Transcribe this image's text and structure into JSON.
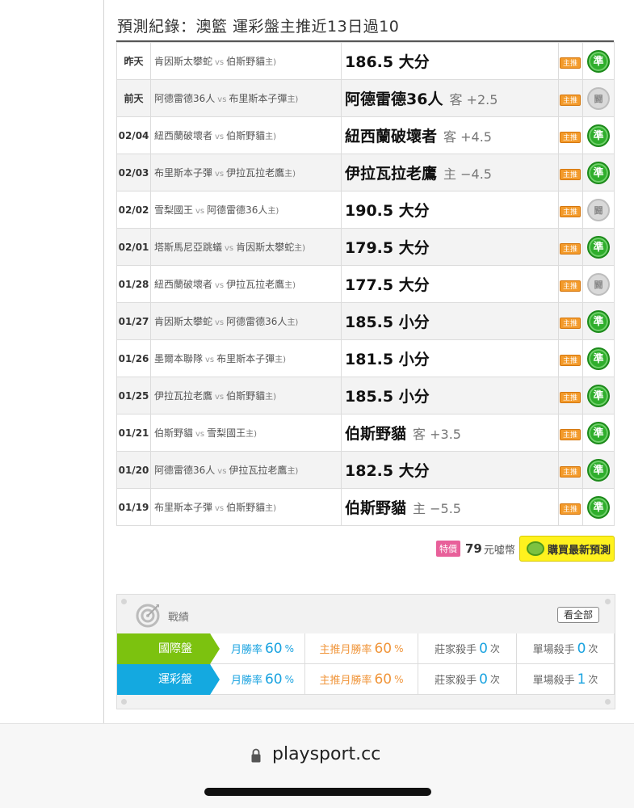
{
  "title": "預測紀錄：澳籃 運彩盤主推近13日過10",
  "tag_label": "主推",
  "vs_label": "vs",
  "records": [
    {
      "date": "昨天",
      "away": "肯因斯太攀蛇",
      "home": "伯斯野貓",
      "home_mark": "主)",
      "pick": "186.5 大分",
      "line": "",
      "result": "準"
    },
    {
      "date": "前天",
      "away": "阿德雷德36人",
      "home": "布里斯本子彈",
      "home_mark": "主)",
      "pick": "阿德雷德36人",
      "line": "客 +2.5",
      "result": "闘"
    },
    {
      "date": "02/04",
      "away": "紐西蘭破壞者",
      "home": "伯斯野貓",
      "home_mark": "主)",
      "pick": "紐西蘭破壞者",
      "line": "客 +4.5",
      "result": "準"
    },
    {
      "date": "02/03",
      "away": "布里斯本子彈",
      "home": "伊拉瓦拉老鷹",
      "home_mark": "主)",
      "pick": "伊拉瓦拉老鷹",
      "line": "主 −4.5",
      "result": "準"
    },
    {
      "date": "02/02",
      "away": "雪梨國王",
      "home": "阿德雷德36人",
      "home_mark": "主)",
      "pick": "190.5 大分",
      "line": "",
      "result": "闘"
    },
    {
      "date": "02/01",
      "away": "塔斯馬尼亞跳蟻",
      "home": "肯因斯太攀蛇",
      "home_mark": "主)",
      "pick": "179.5 大分",
      "line": "",
      "result": "準"
    },
    {
      "date": "01/28",
      "away": "紐西蘭破壞者",
      "home": "伊拉瓦拉老鷹",
      "home_mark": "主)",
      "pick": "177.5 大分",
      "line": "",
      "result": "闘"
    },
    {
      "date": "01/27",
      "away": "肯因斯太攀蛇",
      "home": "阿德雷德36人",
      "home_mark": "主)",
      "pick": "185.5 小分",
      "line": "",
      "result": "準"
    },
    {
      "date": "01/26",
      "away": "墨爾本聯隊",
      "home": "布里斯本子彈",
      "home_mark": "主)",
      "pick": "181.5 小分",
      "line": "",
      "result": "準"
    },
    {
      "date": "01/25",
      "away": "伊拉瓦拉老鷹",
      "home": "伯斯野貓",
      "home_mark": "主)",
      "pick": "185.5 小分",
      "line": "",
      "result": "準"
    },
    {
      "date": "01/21",
      "away": "伯斯野貓",
      "home": "雪梨國王",
      "home_mark": "主)",
      "pick": "伯斯野貓",
      "line": "客 +3.5",
      "result": "準"
    },
    {
      "date": "01/20",
      "away": "阿德雷德36人",
      "home": "伊拉瓦拉老鷹",
      "home_mark": "主)",
      "pick": "182.5 大分",
      "line": "",
      "result": "準"
    },
    {
      "date": "01/19",
      "away": "布里斯本子彈",
      "home": "伯斯野貓",
      "home_mark": "主)",
      "pick": "伯斯野貓",
      "line": "主 −5.5",
      "result": "準"
    }
  ],
  "price": {
    "badge": "特價",
    "amount": "79",
    "unit": "元噓幣"
  },
  "buy_button": "購買最新預測",
  "stats": {
    "header": "戰績",
    "see_all": "看全部",
    "rows": [
      {
        "label": "國際盤",
        "color": "#7cc20f",
        "monthly_label": "月勝率",
        "monthly_value": "60",
        "monthly_unit": "%",
        "main_label": "主推月勝率",
        "main_value": "60",
        "main_unit": "%",
        "killer_label": "莊家殺手",
        "killer_value": "0",
        "killer_unit": "次",
        "single_label": "單場殺手",
        "single_value": "0",
        "single_unit": "次"
      },
      {
        "label": "運彩盤",
        "color": "#14a9e0",
        "monthly_label": "月勝率",
        "monthly_value": "60",
        "monthly_unit": "%",
        "main_label": "主推月勝率",
        "main_value": "60",
        "main_unit": "%",
        "killer_label": "莊家殺手",
        "killer_value": "0",
        "killer_unit": "次",
        "single_label": "單場殺手",
        "single_value": "1",
        "single_unit": "次"
      }
    ]
  },
  "browser": {
    "url": "playsport.cc"
  },
  "colors": {
    "monthly": "#1aa3e0",
    "main": "#f0953a",
    "green": "#2fae2c",
    "orange_tag": "#f39a2a"
  }
}
